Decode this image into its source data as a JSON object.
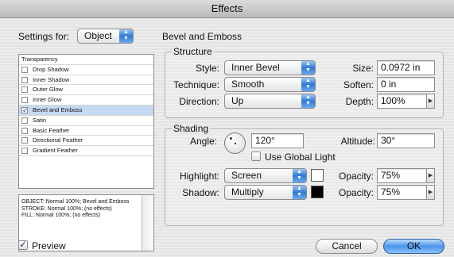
{
  "window": {
    "title": "Effects"
  },
  "settings_for": {
    "label": "Settings for:",
    "value": "Object"
  },
  "panel_title": "Bevel and Emboss",
  "effects_list": {
    "header": "Transparency",
    "items": [
      {
        "label": "Drop Shadow",
        "checked": false
      },
      {
        "label": "Inner Shadow",
        "checked": false
      },
      {
        "label": "Outer Glow",
        "checked": false
      },
      {
        "label": "Inner Glow",
        "checked": false
      },
      {
        "label": "Bevel and Emboss",
        "checked": true
      },
      {
        "label": "Satin",
        "checked": false
      },
      {
        "label": "Basic Feather",
        "checked": false
      },
      {
        "label": "Directional Feather",
        "checked": false
      },
      {
        "label": "Gradient Feather",
        "checked": false
      }
    ]
  },
  "summary": {
    "line1": "OBJECT: Normal 100%; Bevel and Emboss",
    "line2": "STROKE: Normal 100%; (no effects)",
    "line3": "FILL: Normal 100%; (no effects)"
  },
  "structure": {
    "title": "Structure",
    "style_label": "Style:",
    "style_value": "Inner Bevel",
    "technique_label": "Technique:",
    "technique_value": "Smooth",
    "direction_label": "Direction:",
    "direction_value": "Up",
    "size_label": "Size:",
    "size_value": "0.0972 in",
    "soften_label": "Soften:",
    "soften_value": "0 in",
    "depth_label": "Depth:",
    "depth_value": "100%"
  },
  "shading": {
    "title": "Shading",
    "angle_label": "Angle:",
    "angle_value": "120°",
    "use_global_light_label": "Use Global Light",
    "use_global_light_checked": false,
    "altitude_label": "Altitude:",
    "altitude_value": "30°",
    "highlight_label": "Highlight:",
    "highlight_value": "Screen",
    "highlight_color": "#ffffff",
    "highlight_opacity_label": "Opacity:",
    "highlight_opacity_value": "75%",
    "shadow_label": "Shadow:",
    "shadow_value": "Multiply",
    "shadow_color": "#000000",
    "shadow_opacity_label": "Opacity:",
    "shadow_opacity_value": "75%"
  },
  "preview": {
    "label": "Preview",
    "checked": true
  },
  "buttons": {
    "cancel": "Cancel",
    "ok": "OK"
  },
  "colors": {
    "accent": "#2f79d6",
    "selection": "#c6d9f3"
  }
}
